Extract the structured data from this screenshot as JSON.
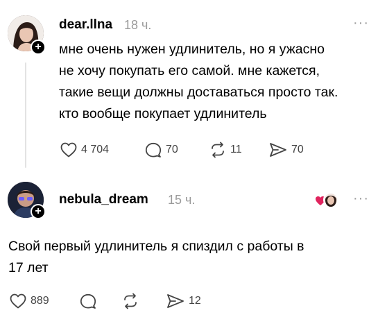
{
  "posts": [
    {
      "username": "dear.llna",
      "time": "18 ч.",
      "more": "···",
      "text_lines": [
        "мне очень нужен удлинитель, но я ужасно",
        "не хочу покупать его самой. мне кажется,",
        "такие вещи должны доставаться просто так.",
        "кто вообще покупает удлинитель"
      ],
      "likes": "4 704",
      "comments": "70",
      "reposts": "11",
      "shares": "70"
    },
    {
      "username": "nebula_dream",
      "time": "15 ч.",
      "more": "···",
      "text_lines": [
        "Свой первый удлинитель я спиздил с работы в",
        "17 лет"
      ],
      "likes": "889",
      "comments": "",
      "reposts": "",
      "shares": "12"
    }
  ],
  "colors": {
    "text": "#000000",
    "muted": "#9a9a9a",
    "like_red": "#e0245e"
  },
  "icons": [
    "heart-icon",
    "comment-icon",
    "repost-icon",
    "share-icon",
    "plus-icon",
    "more-icon"
  ]
}
